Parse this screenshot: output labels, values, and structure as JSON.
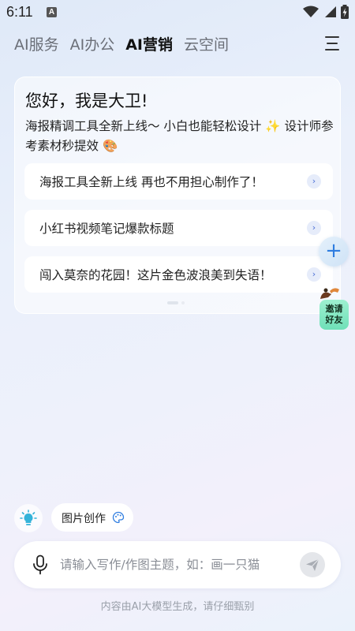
{
  "status_bar": {
    "time": "6:11",
    "notification_letter": "A",
    "icons": [
      "wifi-icon",
      "signal-icon",
      "battery-charging-icon"
    ]
  },
  "tabs": [
    {
      "label": "AI服务",
      "active": false
    },
    {
      "label": "AI办公",
      "active": false
    },
    {
      "label": "AI营销",
      "active": true
    },
    {
      "label": "云空间",
      "active": false
    }
  ],
  "menu_icon": "hamburger-menu-icon",
  "card": {
    "greeting": "您好，我是大卫!",
    "intro_text": "海报精调工具全新上线～ 小白也能轻松设计",
    "intro_sparkle": "✨",
    "intro_text_2": "设计师参考素材秒提效",
    "intro_palette": "🎨",
    "suggestions": [
      {
        "text": "海报工具全新上线 再也不用担心制作了！"
      },
      {
        "text": "小红书视频笔记爆款标题"
      },
      {
        "text": "闯入莫奈的花园！这片金色波浪美到失语！"
      }
    ],
    "pager": {
      "current": 1,
      "total": 2
    }
  },
  "floating": {
    "add_symbol": "+",
    "invite_line1": "邀请",
    "invite_line2": "好友"
  },
  "bottom": {
    "chip_label": "图片创作",
    "input_placeholder": "请输入写作/作图主题，如：画一只猫",
    "input_value": "",
    "disclaimer": "内容由AI大模型生成，请仔细甄别"
  },
  "colors": {
    "accent_blue": "#2f7de0",
    "invite_green": "#6fe0b8",
    "bulb_teal": "#34b3d9"
  }
}
